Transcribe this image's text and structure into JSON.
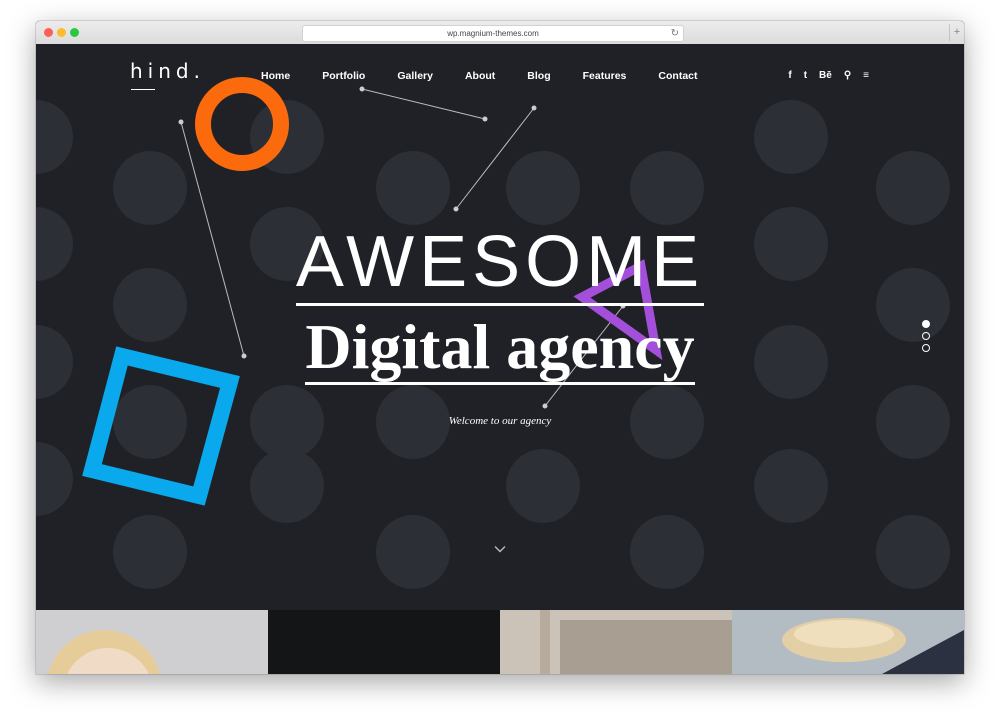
{
  "browser": {
    "url": "wp.magnium-themes.com",
    "reload_icon": "↻",
    "new_tab_icon": "+"
  },
  "site": {
    "logo": "hind.",
    "nav": [
      "Home",
      "Portfolio",
      "Gallery",
      "About",
      "Blog",
      "Features",
      "Contact"
    ],
    "social": [
      {
        "icon": "facebook-icon",
        "glyph": "f"
      },
      {
        "icon": "twitter-icon",
        "glyph": "t"
      },
      {
        "icon": "behance-icon",
        "glyph": "Bē"
      },
      {
        "icon": "search-icon",
        "glyph": "⚲"
      },
      {
        "icon": "menu-icon",
        "glyph": "≡"
      }
    ]
  },
  "hero": {
    "headline": "AWESOME",
    "subheadline": "Digital agency",
    "tagline": "Welcome to our agency",
    "slides_total": 3,
    "active_slide": 1
  },
  "colors": {
    "background": "#1f2126",
    "circle": "#2c2f35",
    "orange": "#fb6a0c",
    "purple": "#a34fd9",
    "blue": "#0aa8ec"
  }
}
